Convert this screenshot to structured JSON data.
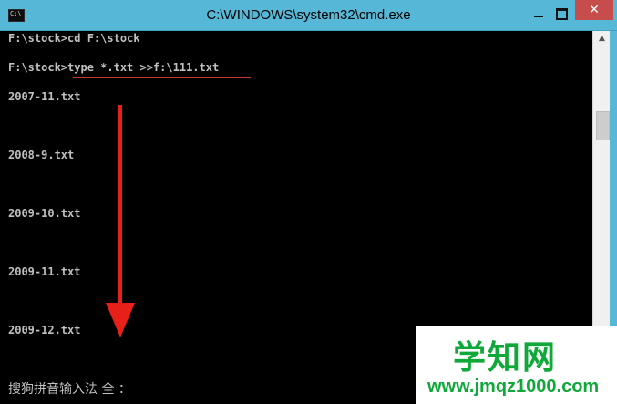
{
  "window": {
    "title": "C:\\WINDOWS\\system32\\cmd.exe",
    "icon_text": "C:\\",
    "minimize_icon": "minimize-icon",
    "maximize_icon": "maximize-icon",
    "close_icon": "close-icon",
    "close_glyph": "✕"
  },
  "console": {
    "lines": [
      "F:\\stock>cd F:\\stock",
      "F:\\stock>type *.txt >>f:\\111.txt",
      "2007-11.txt",
      "2008-9.txt",
      "2009-10.txt",
      "2009-11.txt",
      "2009-12.txt"
    ],
    "ime_status": "搜狗拼音输入法 全 ："
  },
  "scrollbar": {
    "up_glyph": "▲"
  },
  "annotation": {
    "color": "#e8201a"
  },
  "watermark": {
    "title": "学知网",
    "url": "www.jmqz1000.com",
    "color": "#11a83a"
  }
}
